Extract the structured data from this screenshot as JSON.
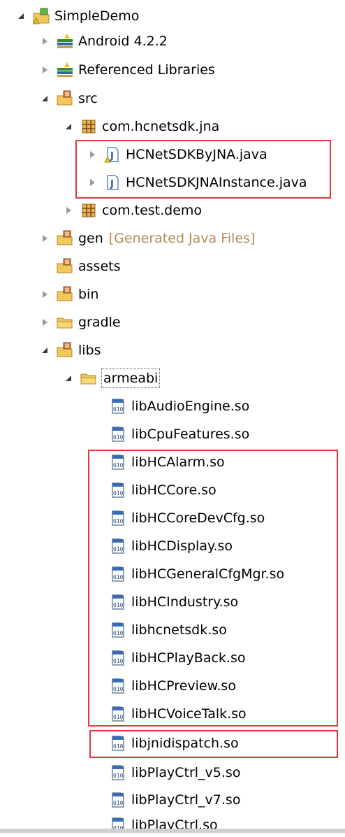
{
  "tree": {
    "project": "SimpleDemo",
    "android": "Android 4.2.2",
    "reflibs": "Referenced Libraries",
    "src": "src",
    "pkg_jna": "com.hcnetsdk.jna",
    "file1": "HCNetSDKByJNA.java",
    "file2": "HCNetSDKJNAInstance.java",
    "pkg_test": "com.test.demo",
    "gen": "gen",
    "gen_note": "[Generated Java Files]",
    "assets": "assets",
    "bin": "bin",
    "gradle": "gradle",
    "libs": "libs",
    "armeabi": "armeabi",
    "so_files": [
      "libAudioEngine.so",
      "libCpuFeatures.so",
      "libHCAlarm.so",
      "libHCCore.so",
      "libHCCoreDevCfg.so",
      "libHCDisplay.so",
      "libHCGeneralCfgMgr.so",
      "libHCIndustry.so",
      "libhcnetsdk.so",
      "libHCPlayBack.so",
      "libHCPreview.so",
      "libHCVoiceTalk.so",
      "libjnidispatch.so",
      "libPlayCtrl_v5.so",
      "libPlayCtrl_v7.so",
      "libPlayCtrl.so"
    ]
  },
  "colors": {
    "highlight": "#e0383a",
    "package": "#c8a060",
    "folder": "#e8b84a"
  }
}
